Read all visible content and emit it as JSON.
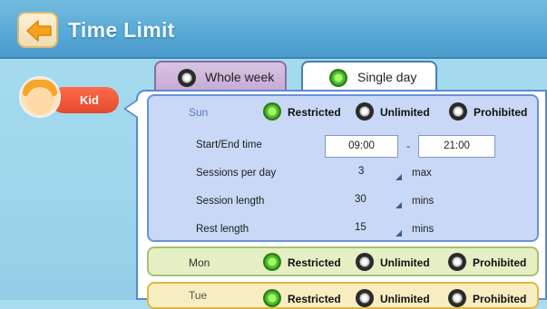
{
  "header": {
    "title": "Time Limit"
  },
  "profile": {
    "name": "Kid"
  },
  "tabs": [
    {
      "label": "Whole week",
      "selected": false
    },
    {
      "label": "Single day",
      "selected": true
    }
  ],
  "days": [
    {
      "name": "Sun",
      "options": [
        "Restricted",
        "Unlimited",
        "Prohibited"
      ],
      "selected": "Restricted",
      "start_end_label": "Start/End time",
      "start_time": "09:00",
      "separator": "-",
      "end_time": "21:00",
      "settings": [
        {
          "label": "Sessions per day",
          "value": "3",
          "unit": "max"
        },
        {
          "label": "Session length",
          "value": "30",
          "unit": "mins"
        },
        {
          "label": "Rest length",
          "value": "15",
          "unit": "mins"
        }
      ]
    },
    {
      "name": "Mon",
      "options": [
        "Restricted",
        "Unlimited",
        "Prohibited"
      ],
      "selected": "Restricted"
    },
    {
      "name": "Tue",
      "options": [
        "Restricted",
        "Unlimited",
        "Prohibited"
      ],
      "selected": "Restricted"
    }
  ],
  "colors": {
    "header": "#5aaad6",
    "accent_green": "#4cc22a",
    "profile": "#e24a2c",
    "back_button": "#f6a21c"
  }
}
